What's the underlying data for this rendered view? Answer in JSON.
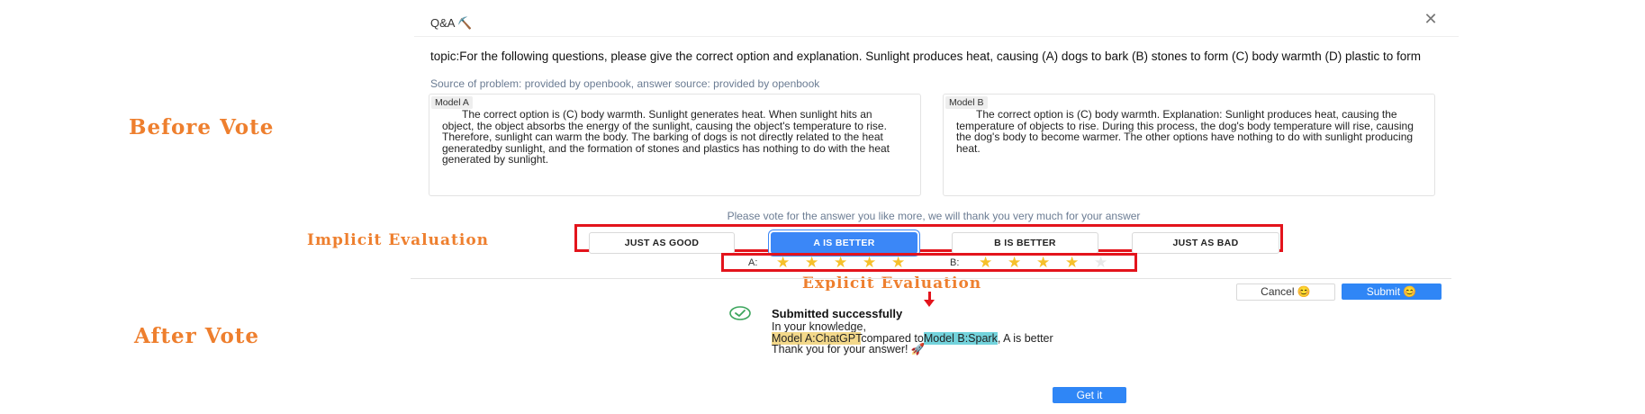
{
  "dialog": {
    "title": "Q&A ⛏️",
    "close_icon": "✕"
  },
  "question": {
    "topic": "topic:For the following questions, please give the correct option and explanation. Sunlight produces heat, causing (A) dogs to bark (B) stones to form (C) body warmth (D) plastic to form",
    "source": "Source of problem: provided by openbook, answer source: provided by openbook"
  },
  "models": [
    {
      "tag": "Model A",
      "answer": "The correct option is (C) body warmth. Sunlight generates heat. When sunlight hits an object, the object absorbs the energy of the sunlight, causing the object's temperature to rise. Therefore, sunlight can warm the body. The barking of dogs is not directly related to the heat generatedby sunlight, and the formation of stones and plastics has nothing to do with the heat generated by sunlight."
    },
    {
      "tag": "Model B",
      "answer": "The correct option is (C) body warmth. Explanation: Sunlight produces heat, causing the temperature of objects to rise. During this process, the dog's body temperature will rise, causing the dog's body to become warmer. The other options have nothing to do with sunlight producing heat."
    }
  ],
  "vote": {
    "prompt": "Please vote for the answer you like more, we will thank you very much for your answer",
    "options": [
      "JUST AS GOOD",
      "A IS BETTER",
      "B IS BETTER",
      "JUST AS BAD"
    ],
    "selected": "A IS BETTER"
  },
  "rating": {
    "a_label": "A:",
    "b_label": "B:",
    "a_stars": 5,
    "b_stars": 4,
    "max_stars": 5
  },
  "actions": {
    "cancel": "Cancel 😊",
    "submit": "Submit 😊"
  },
  "annotations": {
    "before_vote": "Before Vote",
    "implicit": "Implicit Evaluation",
    "explicit": "Explicit Evaluation",
    "after_vote": "After Vote"
  },
  "success": {
    "title": "Submitted successfully",
    "line1": "In your knowledge,",
    "model_a": "Model A:ChatGPT",
    "compared": "compared to",
    "model_b": "Model B:Spark",
    "verdict": ",  A is better",
    "thanks": "Thank you for your answer! 🚀",
    "button": "Get it"
  },
  "colors": {
    "accent": "#2f86f6",
    "annotation": "#ee7f2e",
    "highlight_box": "#e3141c",
    "star": "#f6c12c",
    "hl_yellow": "#f3d88a",
    "hl_cyan": "#73d3dc"
  }
}
